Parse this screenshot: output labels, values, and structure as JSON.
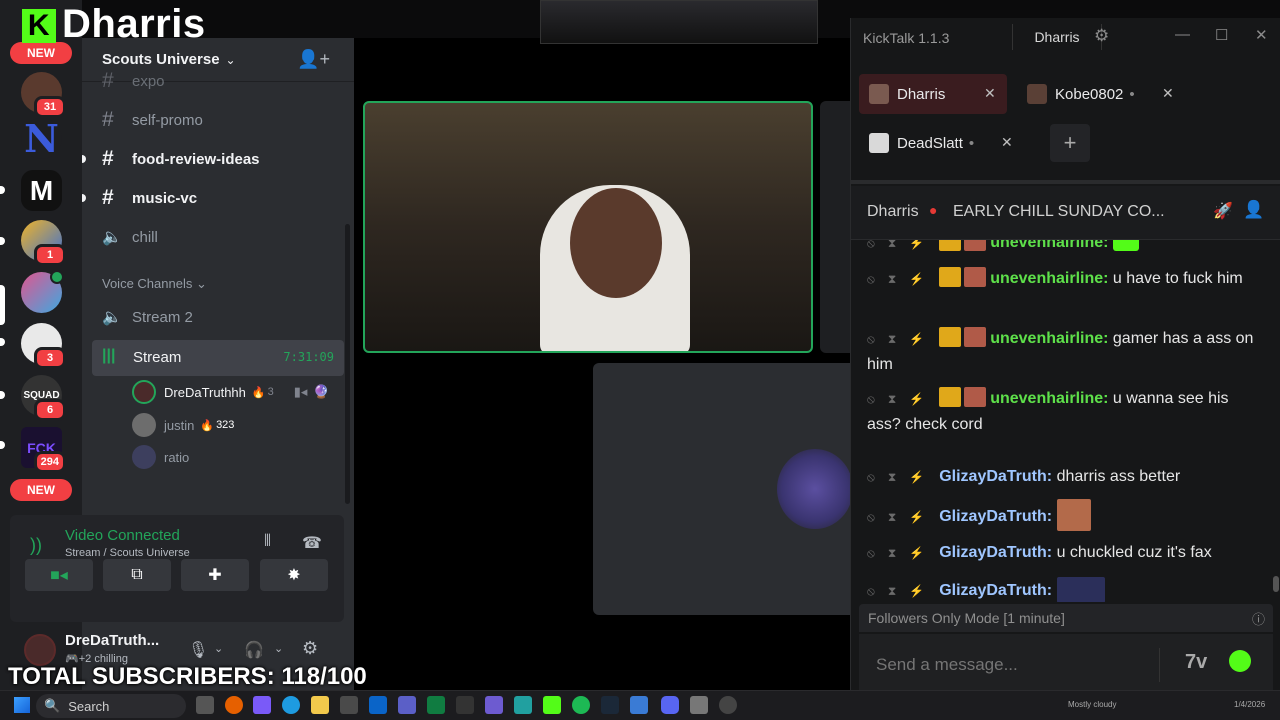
{
  "overlay": {
    "streamer_name": "Dharris",
    "subscribers": "TOTAL SUBSCRIBERS: 118/100"
  },
  "rail": {
    "new_badge": "NEW",
    "servers": [
      {
        "badge": "31"
      },
      {
        "badge": ""
      },
      {
        "badge": ""
      },
      {
        "badge": "1"
      },
      {
        "badge": ""
      },
      {
        "badge": "3"
      },
      {
        "badge": "6"
      },
      {
        "badge": "294"
      }
    ]
  },
  "discord": {
    "server_name": "Scouts Universe",
    "channels": [
      {
        "name": "expo",
        "type": "text"
      },
      {
        "name": "self-promo",
        "type": "text"
      },
      {
        "name": "food-review-ideas",
        "type": "text"
      },
      {
        "name": "music-vc",
        "type": "text"
      },
      {
        "name": "chill",
        "type": "voice"
      }
    ],
    "voice_category": "Voice Channels",
    "voice_channels": [
      {
        "name": "Stream 2"
      },
      {
        "name": "Stream",
        "timer": "7:31:09"
      }
    ],
    "stream_users": [
      {
        "name": "DreDaTruthhh",
        "extra": "3"
      },
      {
        "name": "justin",
        "extra": "323"
      },
      {
        "name": "ratio",
        "extra": ""
      }
    ],
    "voice_panel": {
      "status": "Video Connected",
      "location": "Stream / Scouts Universe"
    },
    "user_panel": {
      "name": "DreDaTruth...",
      "status_count": "+2",
      "status": "chilling"
    },
    "colors": {
      "connected": "#23a55a",
      "accent": "#5865f2"
    }
  },
  "kicktalk": {
    "title": "KickTalk 1.1.3",
    "account": "Dharris",
    "tabs": [
      {
        "name": "Dharris",
        "active": true
      },
      {
        "name": "Kobe0802",
        "active": false
      },
      {
        "name": "DeadSlatt",
        "active": false
      }
    ],
    "add_tab": "+",
    "stream_title": "EARLY CHILL SUNDAY CO...",
    "channel": "Dharris",
    "messages": [
      {
        "user": "unevenhairline:",
        "text": "",
        "color": "green",
        "emote": true
      },
      {
        "user": "unevenhairline:",
        "text": "u have to fuck him",
        "color": "green"
      },
      {
        "user": "unevenhairline:",
        "text": "gamer has a ass on him",
        "color": "green"
      },
      {
        "user": "unevenhairline:",
        "text": "u wanna see his ass? check cord",
        "color": "green"
      },
      {
        "user": "GlizayDaTruth:",
        "text": "dharris ass better",
        "color": "blue"
      },
      {
        "user": "GlizayDaTruth:",
        "text": "",
        "color": "blue",
        "emote": true
      },
      {
        "user": "GlizayDaTruth:",
        "text": "u chuckled cuz it's fax",
        "color": "blue"
      },
      {
        "user": "GlizayDaTruth:",
        "text": "",
        "color": "blue",
        "emote": true
      }
    ],
    "mode_notice": "Followers Only Mode [1 minute]",
    "input_placeholder": "Send a message...",
    "colors": {
      "kick_green": "#53fc18",
      "tab_active": "#3a1c1f"
    }
  },
  "taskbar": {
    "search": "Search",
    "weather": "Mostly cloudy",
    "date": "1/4/2026"
  }
}
